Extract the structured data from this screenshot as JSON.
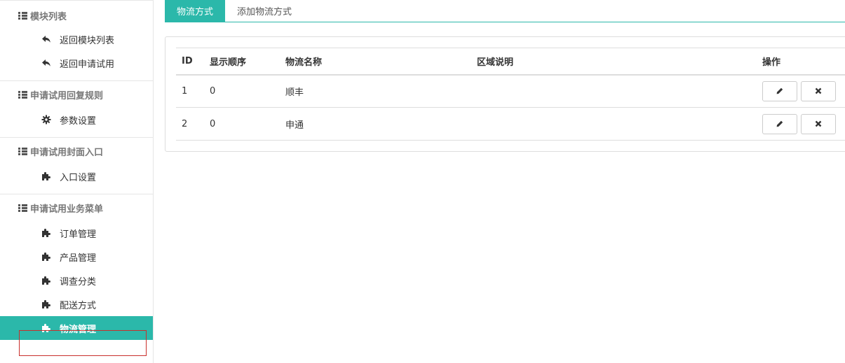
{
  "sidebar": {
    "groups": [
      {
        "title": "模块列表",
        "items": [
          {
            "label": "返回模块列表",
            "icon": "reply-icon"
          },
          {
            "label": "返回申请试用",
            "icon": "reply-icon"
          }
        ]
      },
      {
        "title": "申请试用回复规则",
        "items": [
          {
            "label": "参数设置",
            "icon": "gear-icon"
          }
        ]
      },
      {
        "title": "申请试用封面入口",
        "items": [
          {
            "label": "入口设置",
            "icon": "puzzle-icon"
          }
        ]
      },
      {
        "title": "申请试用业务菜单",
        "items": [
          {
            "label": "订单管理",
            "icon": "puzzle-icon"
          },
          {
            "label": "产品管理",
            "icon": "puzzle-icon"
          },
          {
            "label": "调查分类",
            "icon": "puzzle-icon"
          },
          {
            "label": "配送方式",
            "icon": "puzzle-icon"
          },
          {
            "label": "物流管理",
            "icon": "puzzle-icon",
            "active": true
          }
        ]
      }
    ]
  },
  "tabs": [
    {
      "label": "物流方式",
      "active": true
    },
    {
      "label": "添加物流方式",
      "active": false
    }
  ],
  "table": {
    "headers": {
      "id": "ID",
      "order": "显示顺序",
      "name": "物流名称",
      "region": "区域说明",
      "ops": "操作"
    },
    "rows": [
      {
        "id": "1",
        "order": "0",
        "name": "顺丰",
        "region": ""
      },
      {
        "id": "2",
        "order": "0",
        "name": "申通",
        "region": ""
      }
    ]
  },
  "colors": {
    "accent": "#2bb8aa",
    "highlight_outline": "#c9302c"
  }
}
